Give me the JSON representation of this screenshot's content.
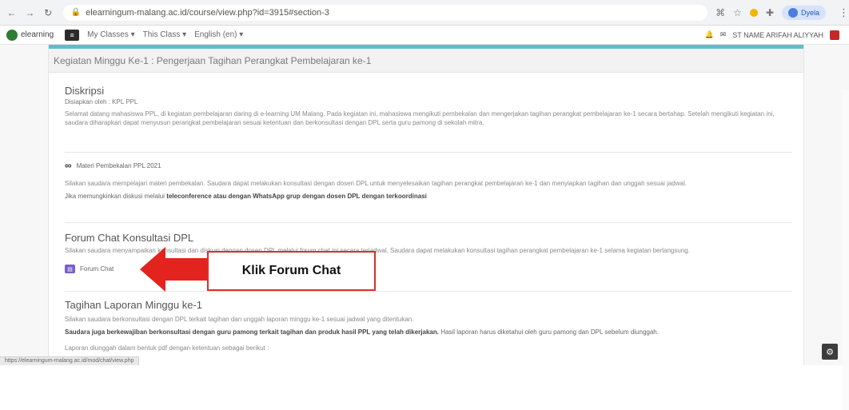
{
  "browser": {
    "url": "elearningum-malang.ac.id/course/view.php?id=3915#section-3",
    "profile": "Dyela"
  },
  "moodle": {
    "site": "elearning",
    "menus": [
      "My Classes ▾",
      "This Class ▾",
      "English (en) ▾"
    ],
    "user": "ST NAME ARIFAH ALIYYAH"
  },
  "page": {
    "header": "Kegiatan Minggu Ke-1 : Pengerjaan Tagihan Perangkat Pembelajaran ke-1"
  },
  "deskripsi": {
    "title": "Diskripsi",
    "sub": "Disiapkan oleh : KPL PPL",
    "text": "Selamat datang mahasiswa PPL, di kegiatan pembelajaran daring di e-learning UM Malang. Pada kegiatan ini, mahasiswa mengikuti pembekalan dan mengerjakan tagihan perangkat pembelajaran ke-1 secara bertahap. Setelah mengikuti kegiatan ini, saudara diharapkan dapat menyusun perangkat pembelajaran sesuai ketentuan dan berkonsultasi dengan DPL serta guru pamong di sekolah mitra."
  },
  "materi": {
    "link_label": "Materi Pembekalan PPL 2021",
    "text": "Silakan saudara mempelajari materi pembekalan. Saudara dapat melakukan konsultasi dengan dosen DPL untuk menyelesaikan tagihan perangkat pembelajaran ke-1 dan menyiapkan tagihan dan unggah sesuai jadwal.",
    "note_prefix": "Jika memungkinkan diskusi melalui",
    "note_bold": "teleconference atau dengan WhatsApp grup dengan dosen DPL dengan terkoordinasi"
  },
  "forum": {
    "title": "Forum Chat Konsultasi DPL",
    "text": "Silakan saudara menyampaikan konsultasi dan diskusi dengan dosen DPL melalui forum chat ini secara terjadwal. Saudara dapat melakukan konsultasi tagihan perangkat pembelajaran ke-1 selama kegiatan berlangsung.",
    "chat_label": "Forum Chat"
  },
  "callout": {
    "label": "Klik Forum Chat"
  },
  "laporan": {
    "title": "Tagihan Laporan  Minggu ke-1",
    "text": "Silakan saudara berkonsultasi dengan DPL terkait tagihan dan unggah laporan minggu ke-1 sesuai jadwal yang ditentukan.",
    "bold": "Saudara juga berkewajiban berkonsultasi dengan guru pamong terkait tagihan dan produk hasil PPL yang telah dikerjakan.",
    "bold_tail": "Hasil laporan harus diketahui oleh guru pamong dan DPL sebelum diunggah.",
    "last": "Laporan diunggah dalam bentuk pdf dengan ketentuan sebagai berikut :"
  },
  "status_tip": "https://elearningum-malang.ac.id/mod/chat/view.php"
}
